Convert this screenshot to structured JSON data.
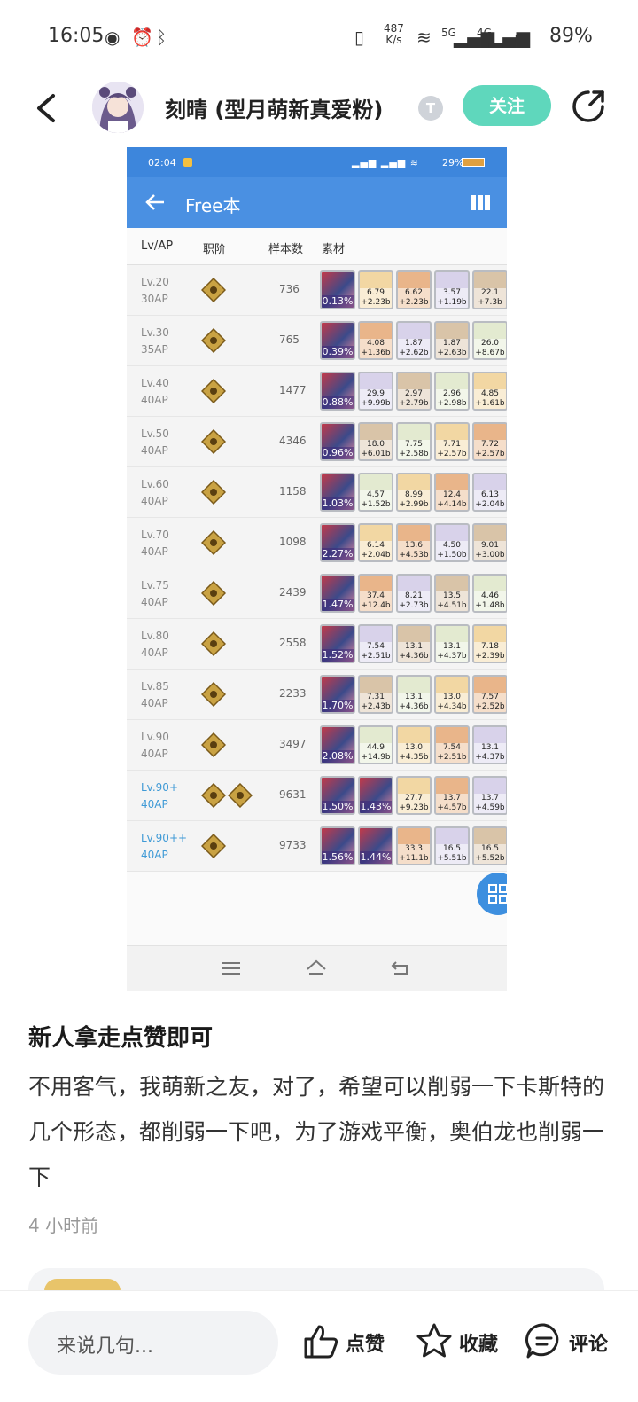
{
  "status_bar": {
    "time": "16:05",
    "net_speed_value": "487",
    "net_speed_unit": "K/s",
    "signal1": "5G",
    "signal2": "4G",
    "battery": "89%"
  },
  "header": {
    "username": "刻晴 (型月萌新真爱粉)",
    "badge": "T",
    "follow_label": "关注"
  },
  "embedded_screenshot": {
    "status_time": "02:04",
    "status_right": "29%",
    "title": "Free本",
    "columns": [
      "Lv/AP",
      "职阶",
      "样本数",
      "素材"
    ],
    "rows": [
      {
        "lv": "Lv.20",
        "ap": "30AP",
        "count": "736",
        "drop": "0.13%",
        "mats": [
          [
            "6.79",
            "+2.23b"
          ],
          [
            "6.62",
            "+2.23b"
          ],
          [
            "3.57",
            "+1.19b"
          ],
          [
            "22.1",
            "+7.3b"
          ]
        ]
      },
      {
        "lv": "Lv.30",
        "ap": "35AP",
        "count": "765",
        "drop": "0.39%",
        "mats": [
          [
            "4.08",
            "+1.36b"
          ],
          [
            "1.87",
            "+2.62b"
          ],
          [
            "1.87",
            "+2.63b"
          ],
          [
            "26.0",
            "+8.67b"
          ]
        ]
      },
      {
        "lv": "Lv.40",
        "ap": "40AP",
        "count": "1477",
        "drop": "0.88%",
        "mats": [
          [
            "29.9",
            "+9.99b"
          ],
          [
            "2.97",
            "+2.79b"
          ],
          [
            "2.96",
            "+2.98b"
          ],
          [
            "4.85",
            "+1.61b"
          ]
        ]
      },
      {
        "lv": "Lv.50",
        "ap": "40AP",
        "count": "4346",
        "drop": "0.96%",
        "mats": [
          [
            "18.0",
            "+6.01b"
          ],
          [
            "7.75",
            "+2.58b"
          ],
          [
            "7.71",
            "+2.57b"
          ],
          [
            "7.72",
            "+2.57b"
          ]
        ]
      },
      {
        "lv": "Lv.60",
        "ap": "40AP",
        "count": "1158",
        "drop": "1.03%",
        "mats": [
          [
            "4.57",
            "+1.52b"
          ],
          [
            "8.99",
            "+2.99b"
          ],
          [
            "12.4",
            "+4.14b"
          ],
          [
            "6.13",
            "+2.04b"
          ]
        ]
      },
      {
        "lv": "Lv.70",
        "ap": "40AP",
        "count": "1098",
        "drop": "2.27%",
        "mats": [
          [
            "6.14",
            "+2.04b"
          ],
          [
            "13.6",
            "+4.53b"
          ],
          [
            "4.50",
            "+1.50b"
          ],
          [
            "9.01",
            "+3.00b"
          ]
        ]
      },
      {
        "lv": "Lv.75",
        "ap": "40AP",
        "count": "2439",
        "drop": "1.47%",
        "mats": [
          [
            "37.4",
            "+12.4b"
          ],
          [
            "8.21",
            "+2.73b"
          ],
          [
            "13.5",
            "+4.51b"
          ],
          [
            "4.46",
            "+1.48b"
          ]
        ]
      },
      {
        "lv": "Lv.80",
        "ap": "40AP",
        "count": "2558",
        "drop": "1.52%",
        "mats": [
          [
            "7.54",
            "+2.51b"
          ],
          [
            "13.1",
            "+4.36b"
          ],
          [
            "13.1",
            "+4.37b"
          ],
          [
            "7.18",
            "+2.39b"
          ]
        ]
      },
      {
        "lv": "Lv.85",
        "ap": "40AP",
        "count": "2233",
        "drop": "1.70%",
        "mats": [
          [
            "7.31",
            "+2.43b"
          ],
          [
            "13.1",
            "+4.36b"
          ],
          [
            "13.0",
            "+4.34b"
          ],
          [
            "7.57",
            "+2.52b"
          ]
        ]
      },
      {
        "lv": "Lv.90",
        "ap": "40AP",
        "count": "3497",
        "drop": "2.08%",
        "mats": [
          [
            "44.9",
            "+14.9b"
          ],
          [
            "13.0",
            "+4.35b"
          ],
          [
            "7.54",
            "+2.51b"
          ],
          [
            "13.1",
            "+4.37b"
          ]
        ]
      },
      {
        "lv": "Lv.90+",
        "ap": "40AP",
        "count": "9631",
        "drop": "1.50%",
        "drop2": "1.43%",
        "mats": [
          [
            "27.7",
            "+9.23b"
          ],
          [
            "13.7",
            "+4.57b"
          ],
          [
            "13.7",
            "+4.59b"
          ]
        ]
      },
      {
        "lv": "Lv.90++",
        "ap": "40AP",
        "count": "9733",
        "drop": "1.56%",
        "drop2": "1.44%",
        "mats": [
          [
            "33.3",
            "+11.1b"
          ],
          [
            "16.5",
            "+5.51b"
          ],
          [
            "16.5",
            "+5.52b"
          ]
        ]
      }
    ]
  },
  "post": {
    "title": "新人拿走点赞即可",
    "body": "不用客气，我萌新之友，对了，希望可以削弱一下卡斯特的几个形态，都削弱一下吧，为了游戏平衡，奥伯龙也削弱一下",
    "time": "4 小时前"
  },
  "bottom_bar": {
    "comment_placeholder": "来说几句...",
    "like_label": "点赞",
    "fav_label": "收藏",
    "comment_label": "评论"
  },
  "colors": {
    "follow": "#5fd7bc",
    "app_bar": "#4a90e2",
    "lv_blue": "#3f9ad6"
  }
}
